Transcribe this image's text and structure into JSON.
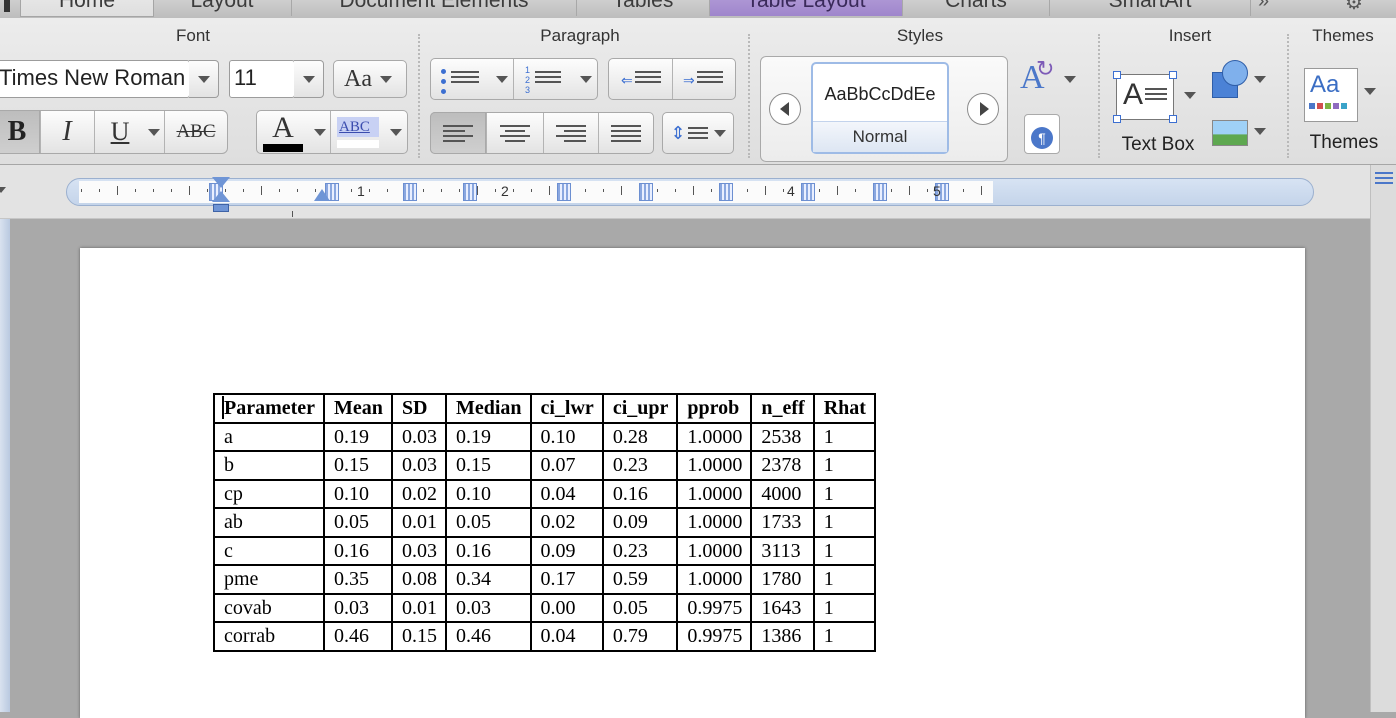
{
  "tabs": [
    "Home",
    "Layout",
    "Document Elements",
    "Tables",
    "Table Layout",
    "Charts",
    "SmartArt"
  ],
  "active_tab": "Table Layout",
  "ribbon": {
    "groups": {
      "font": "Font",
      "paragraph": "Paragraph",
      "styles": "Styles",
      "insert": "Insert",
      "themes": "Themes"
    },
    "font_name": "Times New Roman",
    "font_size": "11",
    "change_case_label": "Aa",
    "bold_label": "B",
    "italic_label": "I",
    "underline_label": "U",
    "strikethrough_label": "ABC",
    "font_color_label": "A",
    "highlight_label": "ABC",
    "style_preview": "AaBbCcDdEe",
    "style_name": "Normal",
    "text_box_label": "Text Box",
    "themes_label": "Themes",
    "themes_preview": "Aa",
    "insert_text_box_glyph": "A",
    "font_color_swatch": "#000000",
    "accent_color": "#8f77c2"
  },
  "ruler": {
    "numbers": [
      "1",
      "2",
      "4",
      "5"
    ]
  },
  "table": {
    "headers": [
      "Parameter",
      "Mean",
      "SD",
      "Median",
      "ci_lwr",
      "ci_upr",
      "pprob",
      "n_eff",
      "Rhat"
    ],
    "rows": [
      [
        "a",
        "0.19",
        "0.03",
        "0.19",
        "0.10",
        "0.28",
        "1.0000",
        "2538",
        "1"
      ],
      [
        "b",
        "0.15",
        "0.03",
        "0.15",
        "0.07",
        "0.23",
        "1.0000",
        "2378",
        "1"
      ],
      [
        "cp",
        "0.10",
        "0.02",
        "0.10",
        "0.04",
        "0.16",
        "1.0000",
        "4000",
        "1"
      ],
      [
        "ab",
        "0.05",
        "0.01",
        "0.05",
        "0.02",
        "0.09",
        "1.0000",
        "1733",
        "1"
      ],
      [
        "c",
        "0.16",
        "0.03",
        "0.16",
        "0.09",
        "0.23",
        "1.0000",
        "3113",
        "1"
      ],
      [
        "pme",
        "0.35",
        "0.08",
        "0.34",
        "0.17",
        "0.59",
        "1.0000",
        "1780",
        "1"
      ],
      [
        "covab",
        "0.03",
        "0.01",
        "0.03",
        "0.00",
        "0.05",
        "0.9975",
        "1643",
        "1"
      ],
      [
        "corrab",
        "0.46",
        "0.15",
        "0.46",
        "0.04",
        "0.79",
        "0.9975",
        "1386",
        "1"
      ]
    ]
  }
}
